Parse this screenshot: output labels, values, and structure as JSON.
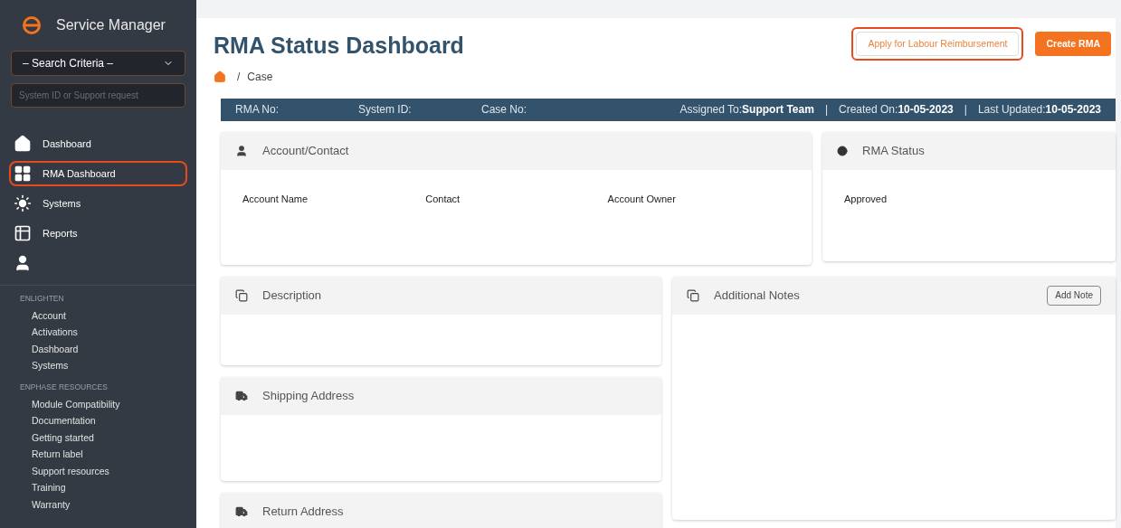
{
  "sidebar": {
    "brand": "Service Manager",
    "search_criteria": {
      "value": "– Search Criteria –"
    },
    "search_field": {
      "placeholder": "System ID or Support request"
    },
    "nav": [
      {
        "kind": "home",
        "label": "Dashboard",
        "highlighted": false
      },
      {
        "kind": "grid",
        "label": "RMA Dashboard",
        "highlighted": true
      },
      {
        "kind": "sun",
        "label": "Systems",
        "highlighted": false
      },
      {
        "kind": "table",
        "label": "Reports",
        "highlighted": false
      },
      {
        "kind": "user",
        "highlighted": false
      }
    ],
    "sections": [
      {
        "title": "ENLIGHTEN",
        "links": [
          "Account",
          "Activations",
          "Dashboard",
          "Systems"
        ]
      },
      {
        "title": "ENPHASE RESOURCES",
        "links": [
          "Module Compatibility",
          "Documentation",
          "Getting started",
          "Return label",
          "Support resources",
          "Training",
          "Warranty"
        ]
      }
    ]
  },
  "main": {
    "title": "RMA Status Dashboard",
    "breadcrumb": [
      {
        "separator": "/",
        "label": "Case"
      }
    ],
    "buttons": [
      {
        "label": "Apply for Labour Reimbursement",
        "kind": "outline",
        "highlighted": true
      },
      {
        "label": "Create RMA",
        "kind": "filled",
        "highlighted": false
      }
    ],
    "info_bar": {
      "left": [
        "RMA No:",
        "System ID:",
        "Case No:"
      ],
      "right": [
        {
          "label": "Assigned To:",
          "value": "Support Team"
        },
        {
          "label": "Created On:",
          "value": "10-05-2023"
        },
        {
          "label": "Last Updated:",
          "value": "10-05-2023"
        }
      ],
      "separator": "|"
    },
    "account_card": {
      "kind": "user",
      "title": "Account/Contact",
      "fields": [
        "Account Name",
        "Contact",
        "Account Owner"
      ]
    },
    "status_card": {
      "kind": "dot",
      "title": "RMA Status",
      "value": "Approved"
    },
    "left_cards": [
      {
        "kind": "copy",
        "title": "Description"
      },
      {
        "kind": "truck",
        "title": "Shipping Address"
      },
      {
        "kind": "truck",
        "title": "Return Address"
      }
    ],
    "notes_card": {
      "kind": "copy",
      "title": "Additional Notes",
      "button": "Add Note"
    }
  }
}
